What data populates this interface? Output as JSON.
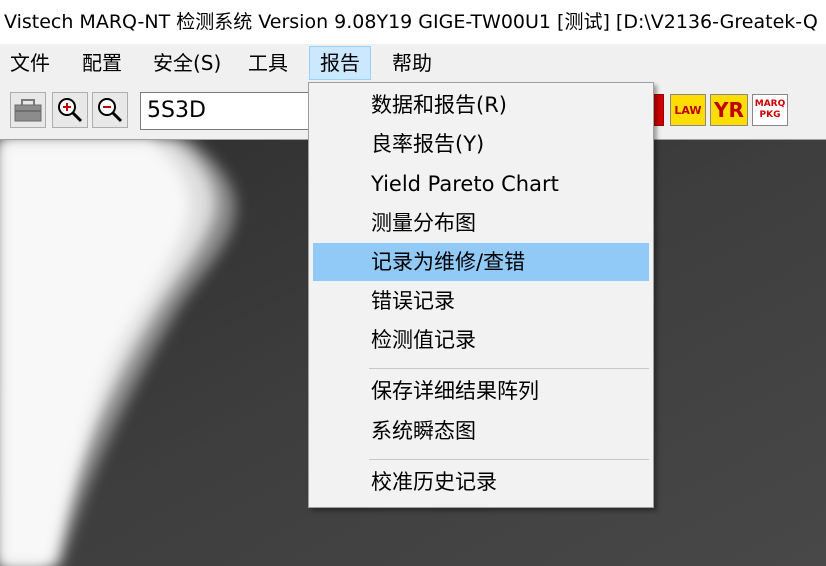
{
  "window": {
    "title": "Vistech MARQ-NT 检测系统 Version 9.08Y19 GIGE-TW00U1 [测试] [D:\\V2136-Greatek-Q"
  },
  "menubar": {
    "items": [
      {
        "label": "文件"
      },
      {
        "label": "配置"
      },
      {
        "label": "安全(S)"
      },
      {
        "label": "工具"
      },
      {
        "label": "报告"
      },
      {
        "label": "帮助"
      }
    ],
    "active": "报告"
  },
  "toolbar": {
    "recipe_value": "5S3D",
    "right_buttons": [
      {
        "icon": "law-icon",
        "label": "LAW"
      },
      {
        "icon": "yr-icon",
        "label": "YR"
      },
      {
        "icon": "marq-pkg-icon",
        "label_top": "MARQ",
        "label_bottom": "PKG"
      }
    ]
  },
  "report_menu": {
    "items": [
      {
        "label": "数据和报告(R)"
      },
      {
        "label": "良率报告(Y)"
      },
      {
        "label": "Yield Pareto Chart"
      },
      {
        "label": "测量分布图"
      },
      {
        "label": "记录为维修/查错"
      },
      {
        "label": "错误记录"
      },
      {
        "label": "检测值记录"
      },
      {
        "label": "保存详细结果阵列"
      },
      {
        "label": "系统瞬态图"
      },
      {
        "label": "校准历史记录"
      }
    ],
    "highlighted": "记录为维修/查错",
    "colors": {
      "highlight": "#91c9f7",
      "menu_active": "#cce8ff"
    }
  }
}
